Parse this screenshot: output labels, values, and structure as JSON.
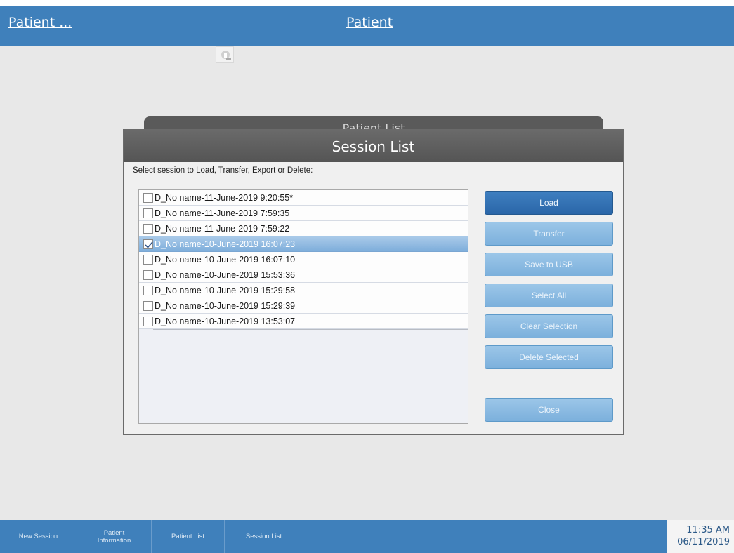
{
  "header": {
    "left_title": "Patient ...",
    "center_title": "Patient"
  },
  "background_dialog": {
    "title": "Patient List"
  },
  "dialog": {
    "title": "Session List",
    "instruction": "Select session to Load, Transfer, Export or Delete:",
    "sessions": [
      {
        "label": "D_No name-11-June-2019 9:20:55*",
        "checked": false,
        "selected": false
      },
      {
        "label": "D_No name-11-June-2019 7:59:35",
        "checked": false,
        "selected": false
      },
      {
        "label": "D_No name-11-June-2019 7:59:22",
        "checked": false,
        "selected": false
      },
      {
        "label": "D_No name-10-June-2019 16:07:23",
        "checked": true,
        "selected": true
      },
      {
        "label": "D_No name-10-June-2019 16:07:10",
        "checked": false,
        "selected": false
      },
      {
        "label": "D_No name-10-June-2019 15:53:36",
        "checked": false,
        "selected": false
      },
      {
        "label": "D_No name-10-June-2019 15:29:58",
        "checked": false,
        "selected": false
      },
      {
        "label": "D_No name-10-June-2019 15:29:39",
        "checked": false,
        "selected": false
      },
      {
        "label": "D_No name-10-June-2019 13:53:07",
        "checked": false,
        "selected": false
      }
    ],
    "buttons": {
      "load": "Load",
      "transfer": "Transfer",
      "save_to_usb": "Save to USB",
      "select_all": "Select All",
      "clear_selection": "Clear Selection",
      "delete_selected": "Delete Selected",
      "close": "Close"
    }
  },
  "taskbar": {
    "items": [
      "New Session",
      "Patient Information",
      "Patient List",
      "Session List"
    ],
    "time": "11:35 AM",
    "date": "06/11/2019"
  },
  "colors": {
    "header_blue": "#3f80bb",
    "dialog_header": "#5a5a5a",
    "primary_button": "#2a66a8",
    "secondary_button": "#8dbbe2",
    "selected_row": "#8fbae2"
  }
}
